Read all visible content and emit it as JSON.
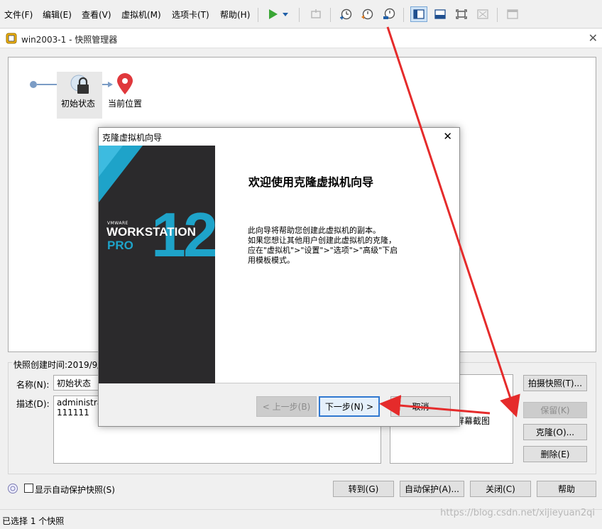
{
  "menubar": {
    "items": [
      "文件(F)",
      "编辑(E)",
      "查看(V)",
      "虚拟机(M)",
      "选项卡(T)",
      "帮助(H)"
    ]
  },
  "manager": {
    "title": "win2003-1 - 快照管理器",
    "tree": {
      "snapshot_label": "初始状态",
      "current_label": "当前位置"
    },
    "info": {
      "created_label": "快照创建时间:2019/9/",
      "name_label": "名称(N):",
      "name_value": "初始状态",
      "desc_label": "描述(D):",
      "desc_value": "administrat\n111111",
      "screenshot_label": "屏幕截图"
    },
    "side_buttons": {
      "take": "拍摄快照(T)...",
      "keep": "保留(K)",
      "clone": "克隆(O)...",
      "delete": "删除(E)"
    },
    "bottom": {
      "show_autoprotect": "显示自动保护快照(S)",
      "goto": "转到(G)",
      "autoprotect": "自动保护(A)...",
      "close": "关闭(C)",
      "help": "帮助"
    },
    "status": "已选择 1 个快照"
  },
  "wizard": {
    "title": "克隆虚拟机向导",
    "heading": "欢迎使用克隆虚拟机向导",
    "body": "此向导将帮助您创建此虚拟机的副本。\n如果您想让其他用户创建此虚拟机的克隆，\n应在\"虚拟机\">\"设置\">\"选项\">\"高级\"下启\n用模板模式。",
    "banner": {
      "vendor": "VMWARE",
      "product": "WORKSTATION",
      "edition": "PRO",
      "version": "12"
    },
    "buttons": {
      "prev": "< 上一步(B)",
      "next": "下一步(N) >",
      "cancel": "取消"
    }
  },
  "watermark": "https://blog.csdn.net/xijieyuan2qi",
  "colors": {
    "accent_teal": "#1ea3c9",
    "arrow_red": "#e52b2b",
    "play_green": "#3aa635",
    "pin_red": "#e0383c"
  }
}
